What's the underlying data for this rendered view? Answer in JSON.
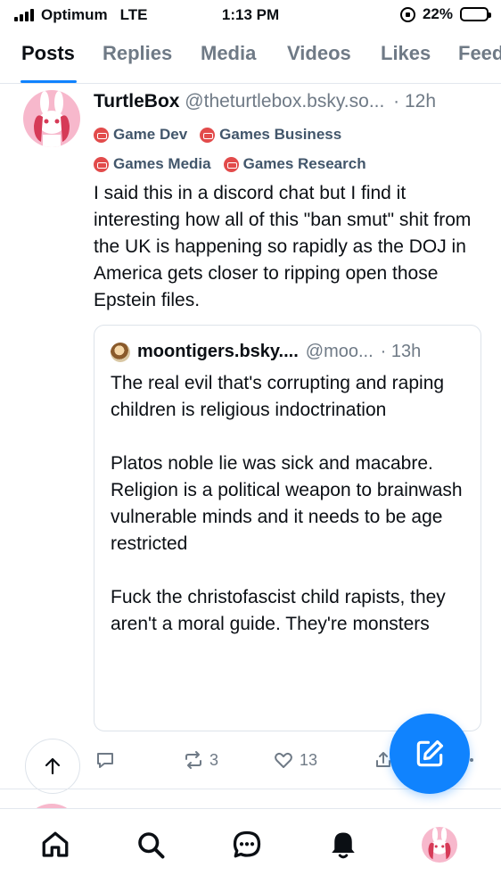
{
  "status_bar": {
    "carrier": "Optimum",
    "network": "LTE",
    "time": "1:13 PM",
    "battery": "22%",
    "battery_level": 0.22
  },
  "tabs": [
    {
      "label": "Posts",
      "active": true
    },
    {
      "label": "Replies",
      "active": false
    },
    {
      "label": "Media",
      "active": false
    },
    {
      "label": "Videos",
      "active": false
    },
    {
      "label": "Likes",
      "active": false
    },
    {
      "label": "Feeds",
      "active": false
    }
  ],
  "post": {
    "display_name": "TurtleBox",
    "handle": "@theturtlebox.bsky.so...",
    "time": "· 12h",
    "labels": [
      "Game Dev",
      "Games Business",
      "Games Media",
      "Games Research"
    ],
    "text": "I said this in a discord chat but I find it interesting how all of this \"ban smut\" shit from the UK is happening so rapidly as the DOJ in America gets closer to ripping open those Epstein files.",
    "quote": {
      "display_name": "moontigers.bsky....",
      "handle": "@moo...",
      "time": "· 13h",
      "text": "The real evil that's corrupting and raping children is religious indoctrination\n\nPlatos noble lie was sick and macabre. Religion is a political weapon to brainwash vulnerable minds and it needs to be age restricted\n\nFuck the christofascist child rapists, they aren't a moral guide. They're monsters"
    },
    "actions": {
      "reposts": "3",
      "likes": "13"
    }
  },
  "colors": {
    "accent": "#1083fe",
    "label_icon": "#e24b4b",
    "muted_text": "#6f7a86"
  },
  "bottom_nav": [
    {
      "icon": "home-icon"
    },
    {
      "icon": "search-icon"
    },
    {
      "icon": "chat-icon"
    },
    {
      "icon": "bell-icon"
    },
    {
      "icon": "profile-avatar"
    }
  ]
}
